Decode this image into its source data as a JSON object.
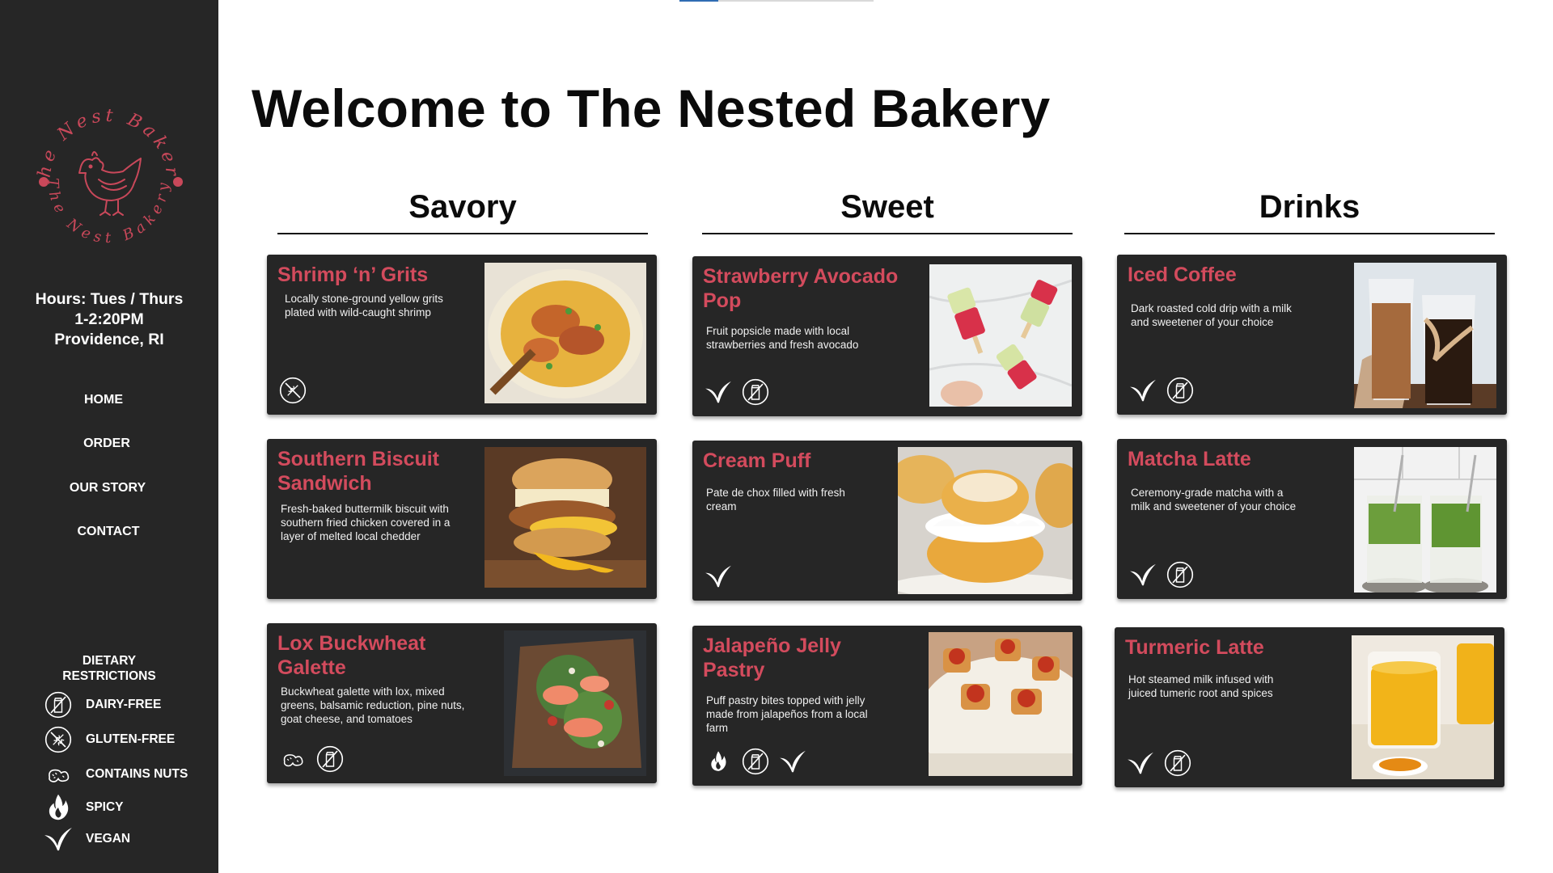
{
  "title": "Welcome to The Nested Bakery",
  "progress": 0.2,
  "colors": {
    "sidebar": "#262626",
    "accent": "#d34b5d",
    "card": "#262626",
    "text_light": "#ffffff"
  },
  "sidebar": {
    "logo": {
      "top_text": "The Nest Bakery",
      "bottom_text": "The Nest Bakery",
      "icon": "hen-icon"
    },
    "hours": [
      "Hours: Tues / Thurs",
      "1-2:20PM",
      "Providence, RI"
    ],
    "nav": [
      "HOME",
      "ORDER",
      "OUR STORY",
      "CONTACT"
    ],
    "dietary_title": [
      "DIETARY",
      "RESTRICTIONS"
    ],
    "legend": [
      {
        "icon": "dairy-free-icon",
        "label": "DAIRY-FREE"
      },
      {
        "icon": "gluten-free-icon",
        "label": "GLUTEN-FREE"
      },
      {
        "icon": "nuts-icon",
        "label": "CONTAINS NUTS"
      },
      {
        "icon": "spicy-icon",
        "label": "SPICY"
      },
      {
        "icon": "vegan-icon",
        "label": "VEGAN"
      }
    ]
  },
  "columns": [
    {
      "heading": "Savory",
      "items": [
        {
          "name": "Shrimp ‘n’ Grits",
          "description": "Locally stone-ground yellow grits plated with wild-caught shrimp",
          "icons": [
            "gluten-free-icon"
          ],
          "image": "shrimp-and-grits-photo"
        },
        {
          "name": "Southern Biscuit Sandwich",
          "description": "Fresh-baked buttermilk biscuit with southern fried chicken covered in a layer of melted local chedder",
          "icons": [],
          "image": "biscuit-sandwich-photo"
        },
        {
          "name": "Lox Buckwheat Galette",
          "description": "Buckwheat galette with lox, mixed greens, balsamic reduction, pine nuts, goat cheese, and tomatoes",
          "icons": [
            "nuts-icon",
            "dairy-free-icon"
          ],
          "image": "lox-galette-photo"
        }
      ]
    },
    {
      "heading": "Sweet",
      "items": [
        {
          "name": "Strawberry Avocado Pop",
          "description": "Fruit popsicle made with local strawberries and fresh avocado",
          "icons": [
            "vegan-icon",
            "dairy-free-icon"
          ],
          "image": "strawberry-avocado-pops-photo"
        },
        {
          "name": "Cream Puff",
          "description": "Pate de chox filled with fresh cream",
          "icons": [
            "vegan-icon"
          ],
          "image": "cream-puff-photo"
        },
        {
          "name": "Jalapeño Jelly Pastry",
          "description": "Puff pastry bites topped with jelly made from jalapeños from a local farm",
          "icons": [
            "spicy-icon",
            "dairy-free-icon",
            "vegan-icon"
          ],
          "image": "jalapeno-pastry-photo"
        }
      ]
    },
    {
      "heading": "Drinks",
      "items": [
        {
          "name": "Iced Coffee",
          "description": "Dark roasted cold drip with a milk and sweetener of your choice",
          "icons": [
            "vegan-icon",
            "dairy-free-icon"
          ],
          "image": "iced-coffee-photo"
        },
        {
          "name": "Matcha Latte",
          "description": "Ceremony-grade matcha with a milk and sweetener of your choice",
          "icons": [
            "vegan-icon",
            "dairy-free-icon"
          ],
          "image": "matcha-latte-photo"
        },
        {
          "name": "Turmeric Latte",
          "description": "Hot steamed milk infused with juiced tumeric root and spices",
          "icons": [
            "vegan-icon",
            "dairy-free-icon"
          ],
          "image": "turmeric-latte-photo"
        }
      ]
    }
  ]
}
